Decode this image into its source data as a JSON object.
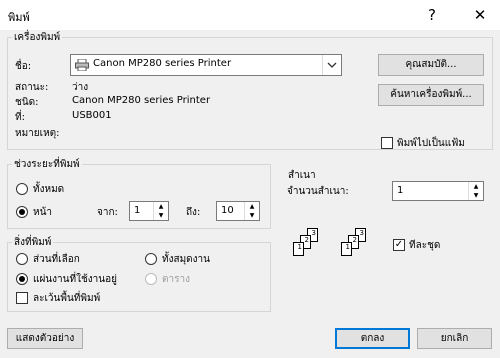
{
  "window": {
    "title": "พิมพ์",
    "help": "?",
    "close": "✕"
  },
  "printer": {
    "group_label": "เครื่องพิมพ์",
    "name_label": "ชื่อ:",
    "name_value": "Canon MP280 series Printer",
    "properties_button": "คุณสมบัติ...",
    "find_button": "ค้นหาเครื่องพิมพ์...",
    "status_label": "สถานะ:",
    "status_value": "ว่าง",
    "type_label": "ชนิด:",
    "type_value": "Canon MP280 series Printer",
    "where_label": "ที่:",
    "where_value": "USB001",
    "comment_label": "หมายเหตุ:",
    "comment_value": "",
    "print_to_file": "พิมพ์ไปเป็นแฟ้ม",
    "print_to_file_checked": false
  },
  "range": {
    "group_label": "ช่วงระยะที่พิมพ์",
    "all_label": "ทั้งหมด",
    "pages_label": "หน้า",
    "from_label": "จาก:",
    "from_value": "1",
    "to_label": "ถึง:",
    "to_value": "10",
    "selected": "pages"
  },
  "copies": {
    "group_label": "สำเนา",
    "count_label": "จำนวนสำเนา:",
    "count_value": "1",
    "collate_label": "ทีละชุด",
    "collate_checked": true,
    "icon_numbers": [
      "1",
      "2",
      "3"
    ]
  },
  "what": {
    "group_label": "สิ่งที่พิมพ์",
    "selection_label": "ส่วนที่เลือก",
    "entire_label": "ทั้งสมุดงาน",
    "active_label": "แผ่นงานที่ใช้งานอยู่",
    "table_label": "ตาราง",
    "ignore_label": "ละเว้นพื้นที่พิมพ์",
    "selected": "active",
    "ignore_checked": false
  },
  "footer": {
    "preview_button": "แสดงตัวอย่าง",
    "ok_button": "ตกลง",
    "cancel_button": "ยกเลิก"
  }
}
